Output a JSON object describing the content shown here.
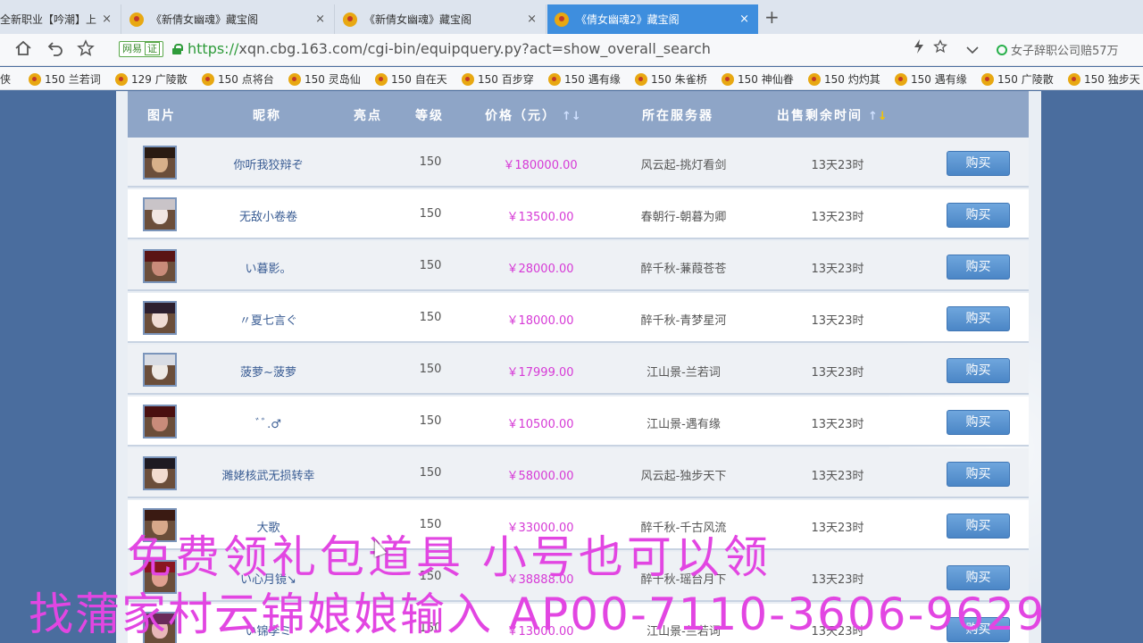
{
  "browser": {
    "tabs": [
      {
        "title": "全新职业【吟潮】上",
        "active": false
      },
      {
        "title": "《新倩女幽魂》藏宝阁",
        "active": false
      },
      {
        "title": "《新倩女幽魂》藏宝阁",
        "active": false
      },
      {
        "title": "《倩女幽魂2》藏宝阁",
        "active": true
      }
    ],
    "close_glyph": "×",
    "new_tab_glyph": "+",
    "url_proto": "https://",
    "url_rest": "xqn.cbg.163.com/cgi-bin/equipquery.py?act=show_overall_search",
    "secure_badge": {
      "part1": "网易",
      "part2": "证"
    },
    "search_hint": "女子辞职公司赔57万",
    "icons": [
      "home-icon",
      "back-icon",
      "star-icon",
      "lightning-icon",
      "bookmark-star-icon",
      "chevron-down-icon",
      "search-ring-icon"
    ]
  },
  "bookmarks": [
    "侠",
    "150 兰若词",
    "129 广陵散",
    "150 点将台",
    "150 灵岛仙",
    "150 自在天",
    "150 百步穿",
    "150 遇有缘",
    "150 朱雀桥",
    "150 神仙眷",
    "150 灼灼其",
    "150 遇有缘",
    "150 广陵散",
    "150 独步天"
  ],
  "table": {
    "headers": {
      "image": "图片",
      "name": "昵称",
      "highlight": "亮点",
      "level": "等级",
      "price": "价格（元）",
      "server": "所在服务器",
      "time": "出售剩余时间"
    },
    "sort_glyph": "↑↓",
    "buy_label": "购买",
    "rows": [
      {
        "name": "你听我狡辩ぞ",
        "level": "150",
        "price": "￥180000.00",
        "server": "风云起-挑灯看剑",
        "time": "13天23时"
      },
      {
        "name": "无敌小卷卷",
        "level": "150",
        "price": "￥13500.00",
        "server": "春朝行-朝暮为卿",
        "time": "13天23时"
      },
      {
        "name": "い暮影。",
        "level": "150",
        "price": "￥28000.00",
        "server": "醉千秋-蒹葭苍苍",
        "time": "13天23时"
      },
      {
        "name": "〃夏七言ぐ",
        "level": "150",
        "price": "￥18000.00",
        "server": "醉千秋-青梦星河",
        "time": "13天23时"
      },
      {
        "name": "菠萝~菠萝",
        "level": "150",
        "price": "￥17999.00",
        "server": "江山景-兰若词",
        "time": "13天23时"
      },
      {
        "name": "ﾞﾞ.♂",
        "level": "150",
        "price": "￥10500.00",
        "server": "江山景-遇有缘",
        "time": "13天23时"
      },
      {
        "name": "濉姥核武无损转幸",
        "level": "150",
        "price": "￥58000.00",
        "server": "风云起-独步天下",
        "time": "13天23时"
      },
      {
        "name": "大歌",
        "level": "150",
        "price": "￥33000.00",
        "server": "醉千秋-千古风流",
        "time": "13天23时"
      },
      {
        "name": "い心月镜↘",
        "level": "150",
        "price": "￥38888.00",
        "server": "醉千秋-瑶台月下",
        "time": "13天23时"
      },
      {
        "name": "い锦李ミ",
        "level": "150",
        "price": "￥13000.00",
        "server": "江山景-兰若词",
        "time": "13天23时"
      }
    ]
  },
  "overlay": {
    "line1": "免费领礼包道具 小号也可以领",
    "line2": "找蒲家村云锦娘娘输入 AP00-7110-3606-9629"
  },
  "colors": {
    "accent": "#3e8ede",
    "header_bg": "#8ea5c7",
    "price": "#d63ad6",
    "overlay": "#e246e2",
    "page_bg": "#4a6d9e"
  }
}
